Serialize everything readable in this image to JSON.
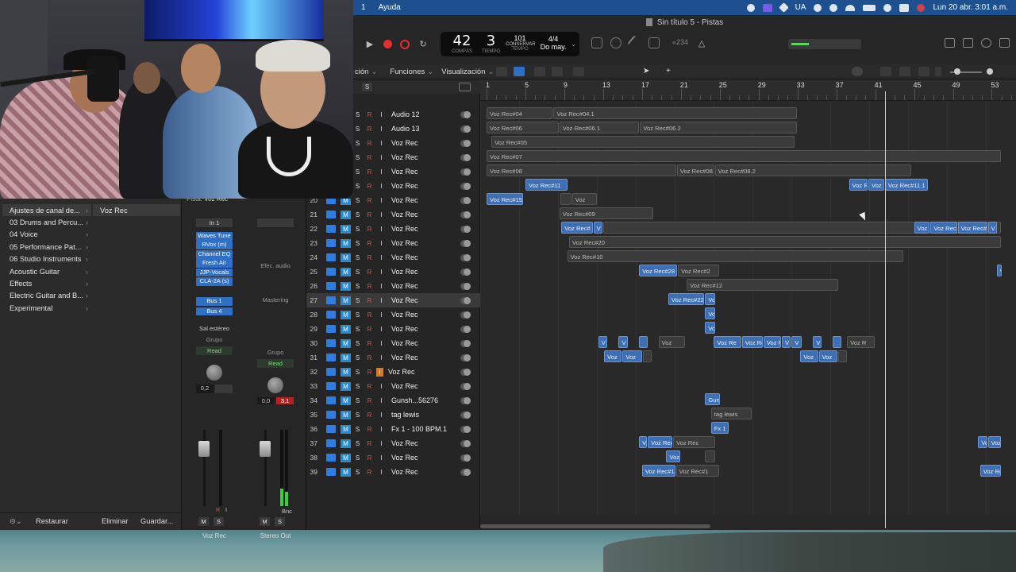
{
  "menubar": {
    "app_number": "1",
    "menu_help": "Ayuda",
    "lang": "UA",
    "clock": "Lun 20 abr.  3:01 a.m."
  },
  "window": {
    "title": "Sin título 5 - Pistas"
  },
  "transport": {
    "bar": "42",
    "beat": "3",
    "bar_label": "COMPÁS",
    "beat_label": "TIEMPO",
    "tempo": "101",
    "tempo_mode": "CONSERVAR",
    "tempo_label": "TEMPO",
    "signature": "4/4",
    "key": "Do may.",
    "cpu_readout": "«234"
  },
  "tracks_menu": {
    "partial": "ción",
    "functions": "Funciones",
    "view": "Visualización"
  },
  "library": {
    "items": [
      "Ajustes de canal de...",
      "03 Drums and Percu...",
      "04 Voice",
      "05 Performance Pat...",
      "06 Studio Instruments",
      "Acoustic Guitar",
      "Effects",
      "Electric Guitar and B...",
      "Experimental"
    ],
    "selected_patch": "Voz Rec",
    "restore": "Restaurar",
    "delete": "Eliminar",
    "save": "Guardar..."
  },
  "inspector": {
    "track_label": "Pista:",
    "track_name": "Voz Rec",
    "input": "In 1",
    "plugins": [
      "Waves Tune",
      "RVox (m)",
      "Channel EQ",
      "Fresh Air",
      "JJP-Vocals",
      "CLA-2A (s)"
    ],
    "audio_fx": "Efec. audio",
    "mastering": "Mastering",
    "sends": [
      "Bus 1",
      "Bus 4"
    ],
    "output": "Sal estéreo",
    "group": "Grupo",
    "automation": "Read",
    "pan_a": "0,2",
    "pan_b": "0,0",
    "peak_b": "3,1",
    "bounce": "Bnc",
    "mute": "M",
    "solo": "S",
    "name_a": "Voz Rec",
    "name_b": "Stereo Out"
  },
  "header_solo": "S",
  "tracks": [
    {
      "num": "",
      "name": "Audio 12",
      "m": false
    },
    {
      "num": "",
      "name": "Audio 13",
      "m": false
    },
    {
      "num": "",
      "name": "Voz Rec",
      "m": false
    },
    {
      "num": "",
      "name": "Voz Rec",
      "m": false
    },
    {
      "num": "",
      "name": "Voz Rec",
      "m": false
    },
    {
      "num": "",
      "name": "Voz Rec",
      "m": false
    },
    {
      "num": "20",
      "name": "Voz Rec",
      "m": true
    },
    {
      "num": "21",
      "name": "Voz Rec",
      "m": true
    },
    {
      "num": "22",
      "name": "Voz Rec",
      "m": true
    },
    {
      "num": "23",
      "name": "Voz Rec",
      "m": true
    },
    {
      "num": "24",
      "name": "Voz Rec",
      "m": true
    },
    {
      "num": "25",
      "name": "Voz Rec",
      "m": true
    },
    {
      "num": "26",
      "name": "Voz Rec",
      "m": true
    },
    {
      "num": "27",
      "name": "Voz Rec",
      "m": true
    },
    {
      "num": "28",
      "name": "Voz Rec",
      "m": true
    },
    {
      "num": "29",
      "name": "Voz Rec",
      "m": true
    },
    {
      "num": "30",
      "name": "Voz Rec",
      "m": true
    },
    {
      "num": "31",
      "name": "Voz Rec",
      "m": true
    },
    {
      "num": "32",
      "name": "Voz Rec",
      "m": true
    },
    {
      "num": "33",
      "name": "Voz Rec",
      "m": true
    },
    {
      "num": "34",
      "name": "Gunsh...56276",
      "m": true
    },
    {
      "num": "35",
      "name": "tag lewis",
      "m": true
    },
    {
      "num": "36",
      "name": "Fx 1 - 100 BPM.1",
      "m": true
    },
    {
      "num": "37",
      "name": "Voz Rec",
      "m": true
    },
    {
      "num": "38",
      "name": "Voz Rec",
      "m": true
    },
    {
      "num": "39",
      "name": "Voz Rec",
      "m": true
    }
  ],
  "track_buttons": {
    "mute": "M",
    "solo": "S",
    "record": "R",
    "input": "I"
  },
  "ruler": [
    "1",
    "5",
    "9",
    "13",
    "17",
    "21",
    "25",
    "29",
    "33",
    "37",
    "41",
    "45",
    "49",
    "53"
  ],
  "regions": [
    {
      "row": 0,
      "start": 1,
      "end": 7.9,
      "label": "Voz Rec#04",
      "c": "gray"
    },
    {
      "row": 0,
      "start": 7.9,
      "end": 33,
      "label": "Voz Rec#04.1",
      "c": "gray"
    },
    {
      "row": 1,
      "start": 1,
      "end": 8.5,
      "label": "Voz Rec#06",
      "c": "gray"
    },
    {
      "row": 1,
      "start": 8.5,
      "end": 16.8,
      "label": "Voz Rec#06.1",
      "c": "gray"
    },
    {
      "row": 1,
      "start": 16.8,
      "end": 33,
      "label": "Voz Rec#06.2",
      "c": "gray"
    },
    {
      "row": 2,
      "start": 1.5,
      "end": 32.8,
      "label": "Voz Rec#05",
      "c": "gray"
    },
    {
      "row": 3,
      "start": 1,
      "end": 54,
      "label": "Voz Rec#07",
      "c": "gray"
    },
    {
      "row": 4,
      "start": 1,
      "end": 20.6,
      "label": "Voz Rec#08",
      "c": "gray"
    },
    {
      "row": 4,
      "start": 20.6,
      "end": 24.5,
      "label": "Voz Rec#08",
      "c": "gray"
    },
    {
      "row": 4,
      "start": 24.5,
      "end": 44.8,
      "label": "Voz Rec#08.2",
      "c": "gray"
    },
    {
      "row": 5,
      "start": 5,
      "end": 9.4,
      "label": "Voz Rec#11",
      "c": "blue"
    },
    {
      "row": 5,
      "start": 38.3,
      "end": 40.3,
      "label": "Voz R",
      "c": "blue"
    },
    {
      "row": 5,
      "start": 40.3,
      "end": 42,
      "label": "Voz",
      "c": "blue"
    },
    {
      "row": 5,
      "start": 42,
      "end": 46.5,
      "label": "Voz Rec#11.1",
      "c": "blue"
    },
    {
      "row": 6,
      "start": 1,
      "end": 4.8,
      "label": "Voz Rec#15",
      "c": "blue"
    },
    {
      "row": 6,
      "start": 8.6,
      "end": 9.8,
      "label": "",
      "c": "gray"
    },
    {
      "row": 6,
      "start": 9.8,
      "end": 12.4,
      "label": "Voz",
      "c": "gray"
    },
    {
      "row": 7,
      "start": 8.5,
      "end": 18.2,
      "label": "Voz Rec#09",
      "c": "gray"
    },
    {
      "row": 8,
      "start": 8.7,
      "end": 12,
      "label": "Voz Rec#",
      "c": "blue"
    },
    {
      "row": 8,
      "start": 12,
      "end": 13,
      "label": "V",
      "c": "blue"
    },
    {
      "row": 8,
      "start": 13,
      "end": 54,
      "label": "",
      "c": "gray"
    },
    {
      "row": 8,
      "start": 45,
      "end": 46.7,
      "label": "Voz",
      "c": "blue"
    },
    {
      "row": 8,
      "start": 46.7,
      "end": 49.5,
      "label": "Voz Rec",
      "c": "blue"
    },
    {
      "row": 8,
      "start": 49.5,
      "end": 52.6,
      "label": "Voz Rec#",
      "c": "blue"
    },
    {
      "row": 8,
      "start": 52.6,
      "end": 53.6,
      "label": "V",
      "c": "blue"
    },
    {
      "row": 9,
      "start": 9.5,
      "end": 54,
      "label": "Voz Rec#20",
      "c": "gray"
    },
    {
      "row": 10,
      "start": 9.3,
      "end": 44,
      "label": "Voz Rec#10",
      "c": "gray"
    },
    {
      "row": 11,
      "start": 16.7,
      "end": 20.7,
      "label": "Voz Rec#28",
      "c": "blue"
    },
    {
      "row": 11,
      "start": 20.7,
      "end": 25,
      "label": "Voz Rec#2",
      "c": "gray"
    },
    {
      "row": 11,
      "start": 53.5,
      "end": 54,
      "label": "Voz Rec#",
      "c": "blue"
    },
    {
      "row": 12,
      "start": 21.6,
      "end": 37.3,
      "label": "Voz Rec#12",
      "c": "gray"
    },
    {
      "row": 13,
      "start": 19.7,
      "end": 23.5,
      "label": "Voz Rec#22",
      "c": "blue"
    },
    {
      "row": 13,
      "start": 23.5,
      "end": 24.6,
      "label": "Vo",
      "c": "blue"
    },
    {
      "row": 14,
      "start": 23.5,
      "end": 24.6,
      "label": "Vo",
      "c": "blue"
    },
    {
      "row": 15,
      "start": 23.5,
      "end": 24.6,
      "label": "Voz",
      "c": "blue"
    },
    {
      "row": 16,
      "start": 12.5,
      "end": 13.5,
      "label": "V",
      "c": "blue"
    },
    {
      "row": 16,
      "start": 14.6,
      "end": 15.6,
      "label": "V",
      "c": "blue"
    },
    {
      "row": 16,
      "start": 16.7,
      "end": 17.7,
      "label": "",
      "c": "blue"
    },
    {
      "row": 16,
      "start": 18.7,
      "end": 21.5,
      "label": "Voz",
      "c": "gray"
    },
    {
      "row": 16,
      "start": 24.4,
      "end": 27.3,
      "label": "Voz Re",
      "c": "blue"
    },
    {
      "row": 16,
      "start": 27.3,
      "end": 29.5,
      "label": "Voz Re",
      "c": "blue"
    },
    {
      "row": 16,
      "start": 29.5,
      "end": 31.4,
      "label": "Voz R",
      "c": "blue"
    },
    {
      "row": 16,
      "start": 31.4,
      "end": 32.4,
      "label": "V",
      "c": "blue"
    },
    {
      "row": 16,
      "start": 32.4,
      "end": 33.5,
      "label": "V",
      "c": "blue"
    },
    {
      "row": 16,
      "start": 34.6,
      "end": 35.6,
      "label": "V",
      "c": "blue"
    },
    {
      "row": 16,
      "start": 36.6,
      "end": 37.6,
      "label": "",
      "c": "blue"
    },
    {
      "row": 16,
      "start": 38.1,
      "end": 41,
      "label": "Voz R",
      "c": "gray"
    },
    {
      "row": 17,
      "start": 13.1,
      "end": 15,
      "label": "Voz",
      "c": "blue"
    },
    {
      "row": 17,
      "start": 15,
      "end": 17.1,
      "label": "Voz",
      "c": "blue"
    },
    {
      "row": 17,
      "start": 17.1,
      "end": 18.1,
      "label": "",
      "c": "gray"
    },
    {
      "row": 17,
      "start": 33.3,
      "end": 35.2,
      "label": "Voz",
      "c": "blue"
    },
    {
      "row": 17,
      "start": 35.2,
      "end": 37.2,
      "label": "Voz",
      "c": "blue"
    },
    {
      "row": 17,
      "start": 37.2,
      "end": 38.2,
      "label": "",
      "c": "gray"
    },
    {
      "row": 20,
      "start": 23.5,
      "end": 25.1,
      "label": "Gun",
      "c": "blue"
    },
    {
      "row": 21,
      "start": 24.1,
      "end": 28.4,
      "label": "tag lewis",
      "c": "gray"
    },
    {
      "row": 22,
      "start": 24.1,
      "end": 26,
      "label": "Fx 1 -",
      "c": "blue"
    },
    {
      "row": 23,
      "start": 16.7,
      "end": 17.6,
      "label": "Vo",
      "c": "blue"
    },
    {
      "row": 23,
      "start": 17.6,
      "end": 20.2,
      "label": "Voz Rec",
      "c": "blue"
    },
    {
      "row": 23,
      "start": 20.2,
      "end": 24.6,
      "label": "Voz Rec",
      "c": "gray"
    },
    {
      "row": 23,
      "start": 51.6,
      "end": 52.6,
      "label": "Vo",
      "c": "blue"
    },
    {
      "row": 23,
      "start": 52.6,
      "end": 54,
      "label": "Voz Re",
      "c": "blue"
    },
    {
      "row": 24,
      "start": 19.5,
      "end": 21,
      "label": "Voz",
      "c": "blue"
    },
    {
      "row": 24,
      "start": 23.5,
      "end": 24.6,
      "label": "",
      "c": "gray"
    },
    {
      "row": 25,
      "start": 17,
      "end": 20.5,
      "label": "Voz Rec#14",
      "c": "blue"
    },
    {
      "row": 25,
      "start": 20.5,
      "end": 25,
      "label": "Voz Rec#1",
      "c": "gray"
    },
    {
      "row": 25,
      "start": 51.8,
      "end": 54,
      "label": "Voz Rec",
      "c": "blue"
    }
  ],
  "colors": {
    "region_blue": "#3e6fb4",
    "region_gray": "#3b3b3b",
    "menubar": "#1e4f8f",
    "meter": "#5fd35f"
  }
}
